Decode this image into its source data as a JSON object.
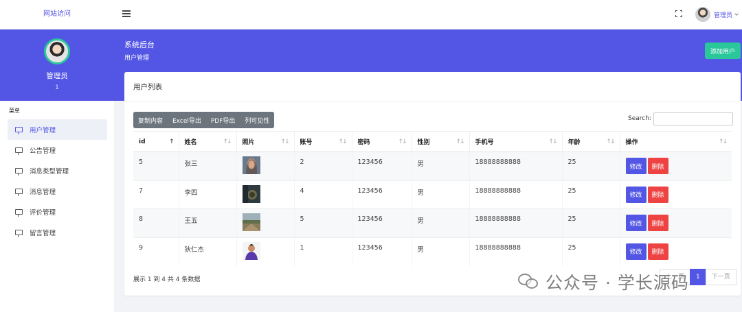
{
  "topbar": {
    "site_link": "网站访问",
    "user_name": "管理员"
  },
  "hero": {
    "title": "系统后台",
    "breadcrumb": "用户管理",
    "add_button": "添加用户"
  },
  "profile": {
    "name": "管理员",
    "id": "1"
  },
  "sidebar": {
    "heading": "菜单",
    "items": [
      {
        "label": "用户管理",
        "active": true
      },
      {
        "label": "公告管理",
        "active": false
      },
      {
        "label": "消息类型管理",
        "active": false
      },
      {
        "label": "消息管理",
        "active": false
      },
      {
        "label": "评价管理",
        "active": false
      },
      {
        "label": "留言管理",
        "active": false
      }
    ]
  },
  "card": {
    "title": "用户列表",
    "export_buttons": [
      "复制内容",
      "Excel导出",
      "PDF导出",
      "列可见性"
    ],
    "search_label": "Search:",
    "search_value": "",
    "columns": [
      "id",
      "姓名",
      "照片",
      "账号",
      "密码",
      "性别",
      "手机号",
      "年龄",
      "操作"
    ],
    "rows": [
      {
        "id": "5",
        "name": "张三",
        "account": "2",
        "password": "123456",
        "gender": "男",
        "phone": "18888888888",
        "age": "25"
      },
      {
        "id": "7",
        "name": "李四",
        "account": "4",
        "password": "123456",
        "gender": "男",
        "phone": "18888888888",
        "age": "25"
      },
      {
        "id": "8",
        "name": "王五",
        "account": "5",
        "password": "123456",
        "gender": "男",
        "phone": "18888888888",
        "age": "25"
      },
      {
        "id": "9",
        "name": "狄仁杰",
        "account": "1",
        "password": "123456",
        "gender": "男",
        "phone": "18888888888",
        "age": "25"
      }
    ],
    "edit_label": "修改",
    "delete_label": "删除",
    "info": "展示 1 到 4 共 4 条数据",
    "pager": {
      "prev": "上一页",
      "current": "1",
      "next": "下一页"
    }
  },
  "watermark": "公众号 · 学长源码",
  "colors": {
    "primary": "#5356e4",
    "success": "#2ac79a",
    "danger": "#ee4343",
    "secondary": "#6c757d"
  }
}
